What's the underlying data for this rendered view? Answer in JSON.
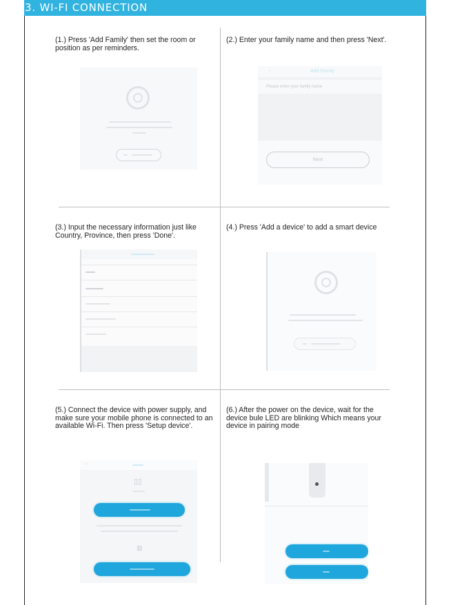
{
  "header": {
    "title": "3. WI-FI CONNECTION"
  },
  "steps": [
    {
      "caption": "(1.) Press 'Add Family' then set the room or position as per reminders."
    },
    {
      "caption": "(2.) Enter your family name and then press 'Next'."
    },
    {
      "caption": "(3.) Input the necessary information just like Country, Province, then press 'Done'."
    },
    {
      "caption": "(4.) Press 'Add a device' to add a smart device"
    },
    {
      "caption": "(5.) Connect the device with power supply, and make sure your mobile phone is connected to an available Wi-Fi. Then press 'Setup device'."
    },
    {
      "caption": "(6.) After the power on the device, wait for the device bule LED are blinking Which means your device  in pairing  mode"
    }
  ],
  "screens": {
    "step2": {
      "title": "Add Family",
      "placeholder": "Please enter your family name",
      "button": "Next"
    }
  },
  "colors": {
    "header_bg": "#31b3e0",
    "accent_blue": "#1fa6dc",
    "screen_bg": "#f4f5f7"
  },
  "icons": [
    "power-icon",
    "back-icon",
    "wifi-device-icon"
  ]
}
